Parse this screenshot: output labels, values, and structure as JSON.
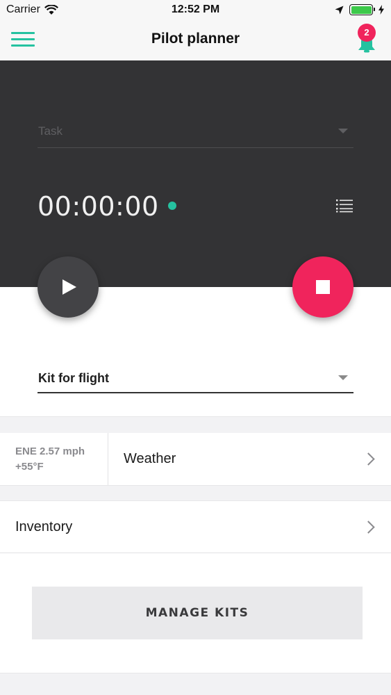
{
  "status_bar": {
    "carrier": "Carrier",
    "time": "12:52 PM",
    "battery_level": 1.0
  },
  "nav": {
    "title": "Pilot planner",
    "notification_count": "2"
  },
  "timer": {
    "task_placeholder": "Task",
    "elapsed": "00:00:00"
  },
  "kit": {
    "selected": "Kit for flight"
  },
  "weather": {
    "wind": "ENE 2.57 mph",
    "temperature": "+55°F",
    "label": "Weather"
  },
  "inventory": {
    "label": "Inventory"
  },
  "actions": {
    "manage_kits_label": "MANAGE KITS"
  },
  "colors": {
    "accent": "#25c2a0",
    "danger": "#f0245c",
    "panel": "#333335"
  }
}
